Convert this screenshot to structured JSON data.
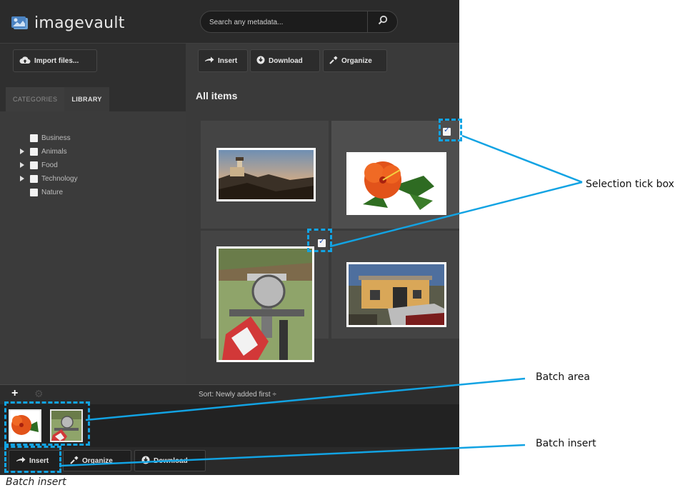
{
  "header": {
    "logo_text": "imagevault",
    "logo_icon": "imagevault-logo-icon",
    "search_placeholder": "Search any metadata...",
    "search_icon": "search-icon"
  },
  "toolbar": {
    "import_label": "Import files...",
    "insert_label": "Insert",
    "download_label": "Download",
    "organize_label": "Organize"
  },
  "sidebar": {
    "tabs": [
      {
        "label": "CATEGORIES",
        "active": false
      },
      {
        "label": "LIBRARY",
        "active": true
      }
    ],
    "categories": [
      {
        "label": "Business",
        "expandable": false
      },
      {
        "label": "Animals",
        "expandable": true
      },
      {
        "label": "Food",
        "expandable": true
      },
      {
        "label": "Technology",
        "expandable": true
      },
      {
        "label": "Nature",
        "expandable": false
      }
    ]
  },
  "main": {
    "title": "All items",
    "items": [
      {
        "subject": "lighthouse at sunset",
        "selected": false
      },
      {
        "subject": "orange hibiscus flower",
        "selected": true
      },
      {
        "subject": "miter saw on workbench",
        "selected": true
      },
      {
        "subject": "yellow building with car",
        "selected": false
      }
    ]
  },
  "bottom": {
    "sort_label": "Sort:",
    "sort_value": "Newly added first",
    "sort_arrow": "÷",
    "add_icon": "plus-icon",
    "settings_icon": "gear-icon"
  },
  "batch": {
    "items": [
      "orange hibiscus flower",
      "miter saw on workbench"
    ],
    "insert_label": "Insert",
    "organize_label": "Organize",
    "download_label": "Download"
  },
  "annotations": {
    "selection_tick_box": "Selection tick box",
    "batch_area": "Batch area",
    "batch_insert": "Batch insert",
    "caption": "Batch insert",
    "accent_color": "#12a3e3"
  }
}
